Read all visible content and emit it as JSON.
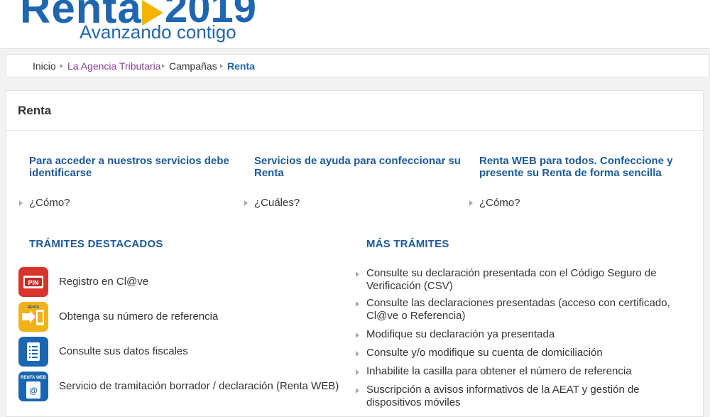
{
  "header": {
    "logo_word": "Renta",
    "logo_year": "2019",
    "logo_subtitle": "Avanzando contigo"
  },
  "breadcrumb": {
    "items": [
      "Inicio",
      "La Agencia Tributaria",
      "Campañas",
      "Renta"
    ]
  },
  "panel": {
    "title": "Renta"
  },
  "columns": [
    {
      "heading": "Para acceder a nuestros servicios debe identificarse",
      "link": "¿Cómo?"
    },
    {
      "heading": "Servicios de ayuda para confeccionar su Renta",
      "link": "¿Cuáles?"
    },
    {
      "heading": "Renta WEB para todos. Confeccione y presente su Renta de forma sencilla",
      "link": "¿Cómo?"
    }
  ],
  "tramites_destacados": {
    "heading": "TRÁMITES DESTACADOS",
    "items": [
      {
        "label": "Registro en Cl@ve",
        "icon": "pin-card-icon",
        "icon_text": "PIN",
        "color": "#d9342b"
      },
      {
        "label": "Obtenga su número de referencia",
        "icon": "renta-phone-icon",
        "icon_text": "RENTA",
        "color": "#f0b21c"
      },
      {
        "label": "Consulte sus datos fiscales",
        "icon": "document-list-icon",
        "icon_text": "",
        "color": "#1a66b0"
      },
      {
        "label": "Servicio de tramitación borrador / declaración (Renta WEB)",
        "icon": "renta-web-icon",
        "icon_text": "RENTA WEB",
        "color": "#1a66b0"
      }
    ]
  },
  "mas_tramites": {
    "heading": "MÁS TRÁMITES",
    "items": [
      "Consulte su declaración presentada con el Código Seguro de Verificación (CSV)",
      "Consulte las declaraciones presentadas (acceso con certificado, Cl@ve o Referencia)",
      "Modifique su declaración ya presentada",
      "Consulte y/o modifique su cuenta de domiciliación",
      "Inhabilite la casilla para obtener el número de referencia",
      "Suscripción a avisos informativos de la AEAT y gestión de dispositivos móviles"
    ]
  }
}
